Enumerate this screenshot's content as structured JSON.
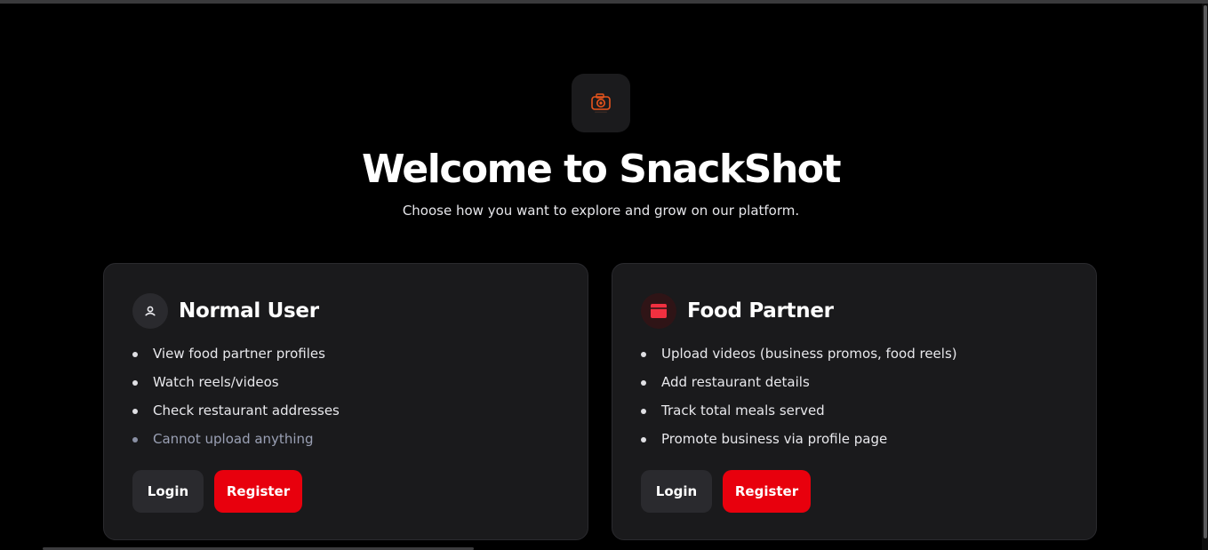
{
  "app": {
    "title": "Welcome to SnackShot",
    "subtitle": "Choose how you want to explore and grow on our platform."
  },
  "logo": {
    "icon": "camera-logo-icon",
    "accent": "#e8541c"
  },
  "cards": {
    "user": {
      "title": "Normal User",
      "icon": "user-icon",
      "features": [
        "View food partner profiles",
        "Watch reels/videos",
        "Check restaurant addresses",
        "Cannot upload anything"
      ],
      "login_label": "Login",
      "register_label": "Register"
    },
    "partner": {
      "title": "Food Partner",
      "icon": "store-icon",
      "features": [
        "Upload videos (business promos, food reels)",
        "Add restaurant details",
        "Track total meals served",
        "Promote business via profile page"
      ],
      "login_label": "Login",
      "register_label": "Register"
    }
  },
  "colors": {
    "background": "#000000",
    "card": "#1a1a1c",
    "accent": "#e8000d",
    "muted_text": "#9aa0b4"
  }
}
